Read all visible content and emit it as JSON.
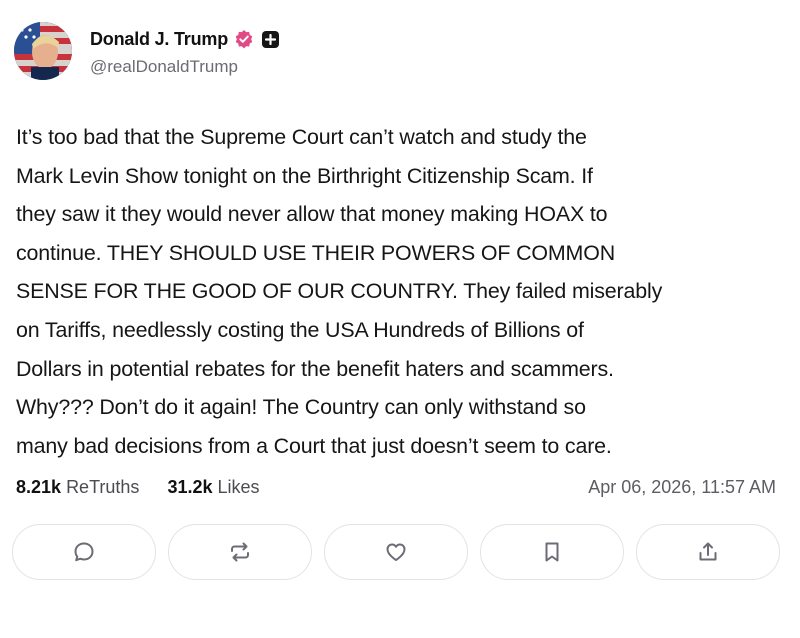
{
  "author": {
    "display_name": "Donald J. Trump",
    "handle": "@realDonaldTrump"
  },
  "post": {
    "text": "It’s too bad that the Supreme Court can’t watch and study the\nMark Levin Show tonight on the Birthright Citizenship Scam. If\nthey saw it they would never allow that money making HOAX to\ncontinue. THEY SHOULD USE THEIR POWERS OF COMMON\nSENSE FOR THE GOOD OF OUR COUNTRY. They failed miserably\non Tariffs, needlessly costing the USA Hundreds of Billions of\nDollars in potential rebates for the benefit haters and scammers.\nWhy??? Don’t do it again! The Country can only withstand so\nmany bad decisions from a Court that just doesn’t seem to care."
  },
  "stats": {
    "retruths_count": "8.21k",
    "retruths_label": "ReTruths",
    "likes_count": "31.2k",
    "likes_label": "Likes",
    "timestamp": "Apr 06, 2026, 11:57 AM"
  },
  "actions": [
    {
      "icon": "reply-icon"
    },
    {
      "icon": "retruth-icon"
    },
    {
      "icon": "like-icon"
    },
    {
      "icon": "bookmark-icon"
    },
    {
      "icon": "share-icon"
    }
  ],
  "colors": {
    "verified_badge": "#e14a86",
    "icon_stroke": "#6c6c74",
    "button_border": "#e3e3e8"
  }
}
